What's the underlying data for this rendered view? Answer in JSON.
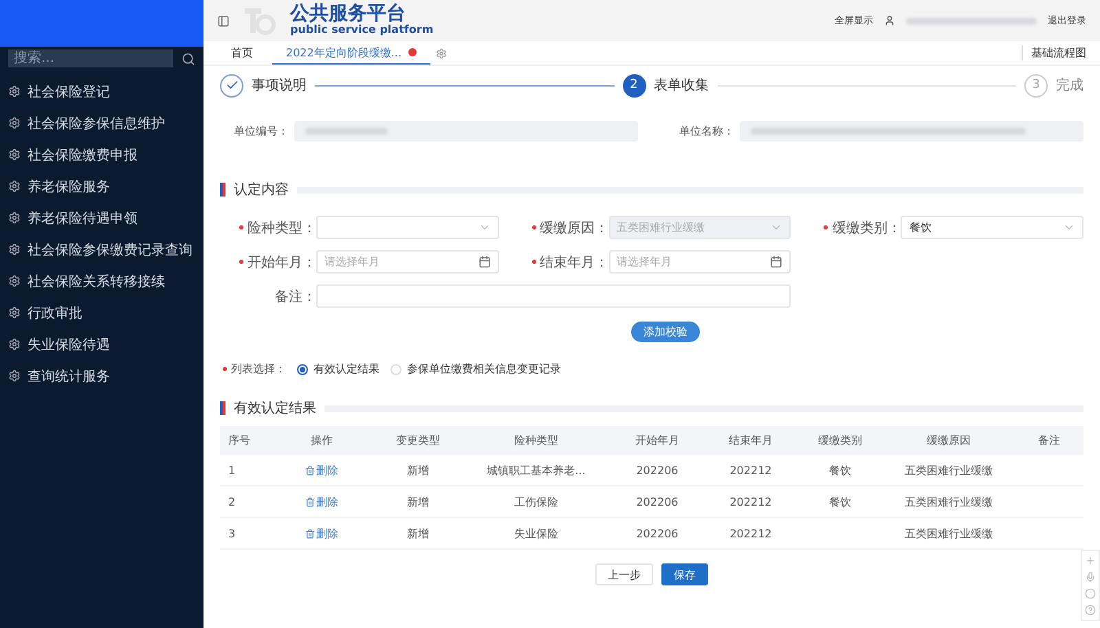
{
  "sidebar": {
    "search": {
      "placeholder": "搜索..."
    },
    "items": [
      {
        "label": "社会保险登记"
      },
      {
        "label": "社会保险参保信息维护"
      },
      {
        "label": "社会保险缴费申报"
      },
      {
        "label": "养老保险服务"
      },
      {
        "label": "养老保险待遇申领"
      },
      {
        "label": "社会保险参保缴费记录查询"
      },
      {
        "label": "社会保险关系转移接续"
      },
      {
        "label": "行政审批"
      },
      {
        "label": "失业保险待遇"
      },
      {
        "label": "查询统计服务"
      }
    ]
  },
  "header": {
    "title": "公共服务平台",
    "subtitle": "public service platform",
    "fullscreen": "全屏显示",
    "logout": "退出登录"
  },
  "tabs": [
    {
      "label": "首页",
      "selected": false,
      "closable": false
    },
    {
      "label": "2022年定向阶段缓缴...",
      "selected": true,
      "closable": true
    }
  ],
  "flow_link": "基础流程图",
  "steps": [
    {
      "label": "事项说明",
      "completed": true,
      "selected": false
    },
    {
      "number": "2",
      "label": "表单收集",
      "completed": false,
      "selected": true
    },
    {
      "number": "3",
      "label": "完成",
      "completed": false,
      "selected": false
    }
  ],
  "unit_fields": [
    {
      "label": "单位编号："
    },
    {
      "label": "单位名称："
    }
  ],
  "section_1": {
    "title": "认定内容"
  },
  "form_fields": [
    {
      "label": "险种类型：",
      "kind": "select",
      "required": true,
      "disabled": false
    },
    {
      "label": "缓缴原因：",
      "kind": "select",
      "required": true,
      "disabled": true,
      "value": "五类困难行业缓缴"
    },
    {
      "label": "缓缴类别：",
      "kind": "select",
      "required": true,
      "disabled": false,
      "value": "餐饮"
    },
    {
      "label": "开始年月：",
      "kind": "date",
      "required": true,
      "disabled": false,
      "placeholder": "请选择年月"
    },
    {
      "label": "结束年月：",
      "kind": "date",
      "required": true,
      "disabled": false,
      "placeholder": "请选择年月"
    },
    {
      "label": "备注：",
      "kind": "text",
      "required": false,
      "disabled": false
    }
  ],
  "add_button": "添加校验",
  "list_choice": {
    "label": "列表选择：",
    "required": true,
    "options": [
      {
        "label": "有效认定结果",
        "selected": true
      },
      {
        "label": "参保单位缴费相关信息变更记录",
        "selected": false
      }
    ]
  },
  "section_2": {
    "title": "有效认定结果"
  },
  "table": {
    "columns": [
      "序号",
      "操作",
      "变更类型",
      "险种类型",
      "开始年月",
      "结束年月",
      "缓缴类别",
      "缓缴原因",
      "备注"
    ],
    "rows": [
      {
        "no": "1",
        "action": "删除",
        "change": "新增",
        "insurance": "城镇职工基本养老...",
        "start": "202206",
        "end": "202212",
        "category": "餐饮",
        "reason": "五类困难行业缓缴"
      },
      {
        "no": "2",
        "action": "删除",
        "change": "新增",
        "insurance": "工伤保险",
        "start": "202206",
        "end": "202212",
        "category": "餐饮",
        "reason": "五类困难行业缓缴"
      },
      {
        "no": "3",
        "action": "删除",
        "change": "新增",
        "insurance": "失业保险",
        "start": "202206",
        "end": "202212",
        "category": "",
        "reason": "五类困难行业缓缴"
      }
    ]
  },
  "footer_buttons": [
    {
      "label": "上一步",
      "kind": "secondary"
    },
    {
      "label": "保存",
      "kind": "primary"
    }
  ]
}
